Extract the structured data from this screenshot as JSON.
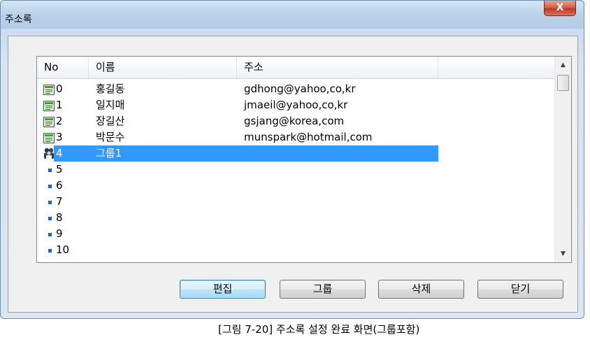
{
  "window": {
    "title": "주소록",
    "close_label": "X"
  },
  "listview": {
    "columns": [
      "No",
      "이름",
      "주소",
      ""
    ],
    "rows": [
      {
        "no": "0",
        "name": "홍길동",
        "email": "gdhong@yahoo,co,kr",
        "icon": "address-book-icon"
      },
      {
        "no": "1",
        "name": "일지매",
        "email": "jmaeil@yahoo,co,kr",
        "icon": "address-book-icon"
      },
      {
        "no": "2",
        "name": "장길산",
        "email": "gsjang@korea,com",
        "icon": "address-book-icon"
      },
      {
        "no": "3",
        "name": "박문수",
        "email": "munspark@hotmail,com",
        "icon": "address-book-icon"
      },
      {
        "no": "4",
        "name": "그룹1",
        "email": "",
        "icon": "group-icon",
        "selected": true
      },
      {
        "no": "5",
        "name": "",
        "email": "",
        "icon": "bullet-icon"
      },
      {
        "no": "6",
        "name": "",
        "email": "",
        "icon": "bullet-icon"
      },
      {
        "no": "7",
        "name": "",
        "email": "",
        "icon": "bullet-icon"
      },
      {
        "no": "8",
        "name": "",
        "email": "",
        "icon": "bullet-icon"
      },
      {
        "no": "9",
        "name": "",
        "email": "",
        "icon": "bullet-icon"
      },
      {
        "no": "10",
        "name": "",
        "email": "",
        "icon": "bullet-icon"
      }
    ],
    "selection_color": "#3399ff"
  },
  "buttons": {
    "edit": "편집",
    "group": "그룹",
    "delete": "삭제",
    "close": "닫기"
  },
  "caption": "[그림 7-20] 주소록 설정 완료 화면(그룹포함)"
}
